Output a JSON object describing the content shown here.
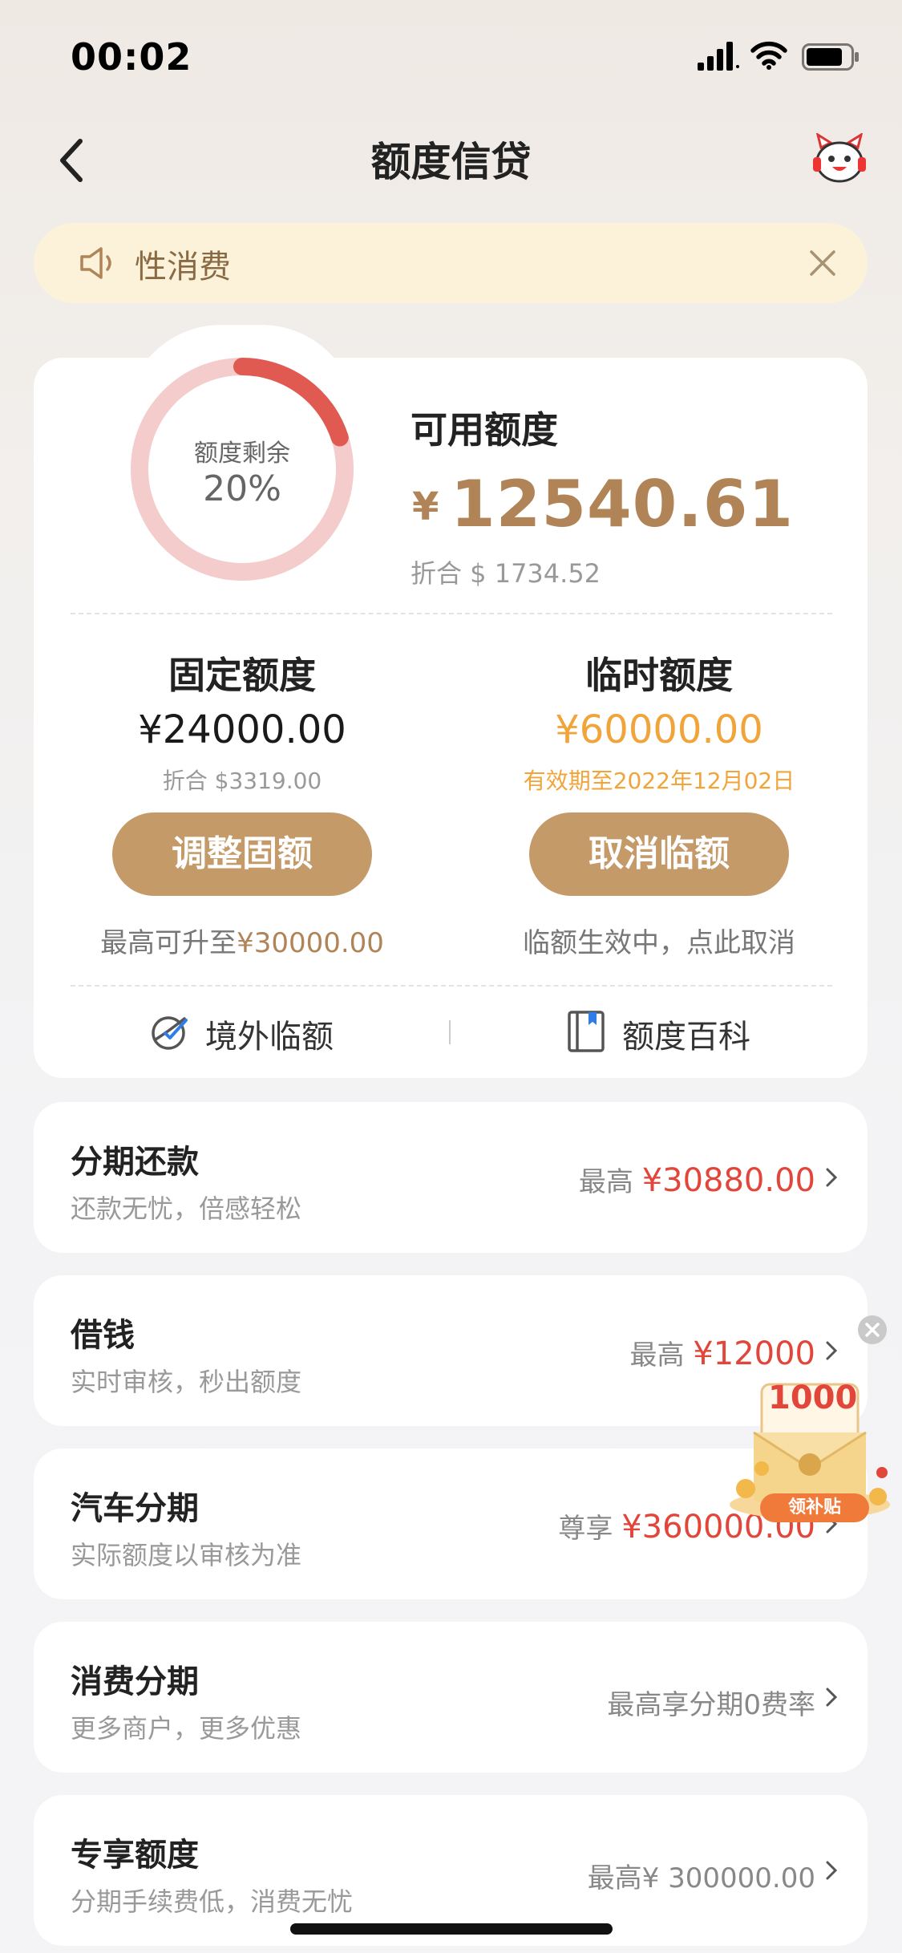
{
  "status_bar": {
    "time": "00:02"
  },
  "nav": {
    "title": "额度信贷"
  },
  "notice": {
    "text": "性消费"
  },
  "credit": {
    "ring_label": "额度剩余",
    "ring_percent_text": "20%",
    "remaining_fraction": 0.2,
    "available_label": "可用额度",
    "available_currency": "¥",
    "available_amount": "12540.61",
    "available_usd": "折合 $ 1734.52",
    "fixed": {
      "title": "固定额度",
      "amount": "¥24000.00",
      "usd": "折合 $3319.00",
      "button": "调整固额",
      "note_prefix": "最高可升至",
      "note_amount": "¥30000.00"
    },
    "temp": {
      "title": "临时额度",
      "amount": "¥60000.00",
      "validity": "有效期至2022年12月02日",
      "button": "取消临额",
      "note": "临额生效中，点此取消"
    },
    "links": {
      "overseas": "境外临额",
      "encyclopedia": "额度百科"
    }
  },
  "list": [
    {
      "title": "分期还款",
      "sub": "还款无忧，倍感轻松",
      "prefix": "最高",
      "amount": "¥30880.00"
    },
    {
      "title": "借钱",
      "sub": "实时审核，秒出额度",
      "prefix": "最高",
      "amount": "¥12000"
    },
    {
      "title": "汽车分期",
      "sub": "实际额度以审核为准",
      "prefix": "尊享",
      "amount": "¥360000.00"
    },
    {
      "title": "消费分期",
      "sub": "更多商户，更多优惠",
      "text": "最高享分期0费率"
    },
    {
      "title": "专享额度",
      "sub": "分期手续费低，消费无忧",
      "text": "最高¥ 300000.00"
    }
  ],
  "floating_widget": {
    "amount": "1000",
    "button": "领补贴"
  },
  "colors": {
    "accent": "#c49a69",
    "gold": "#b08457",
    "orange": "#f0a43a",
    "red": "#e2463a",
    "ring_track": "#f4cccc",
    "ring_fill": "#e05a52"
  }
}
